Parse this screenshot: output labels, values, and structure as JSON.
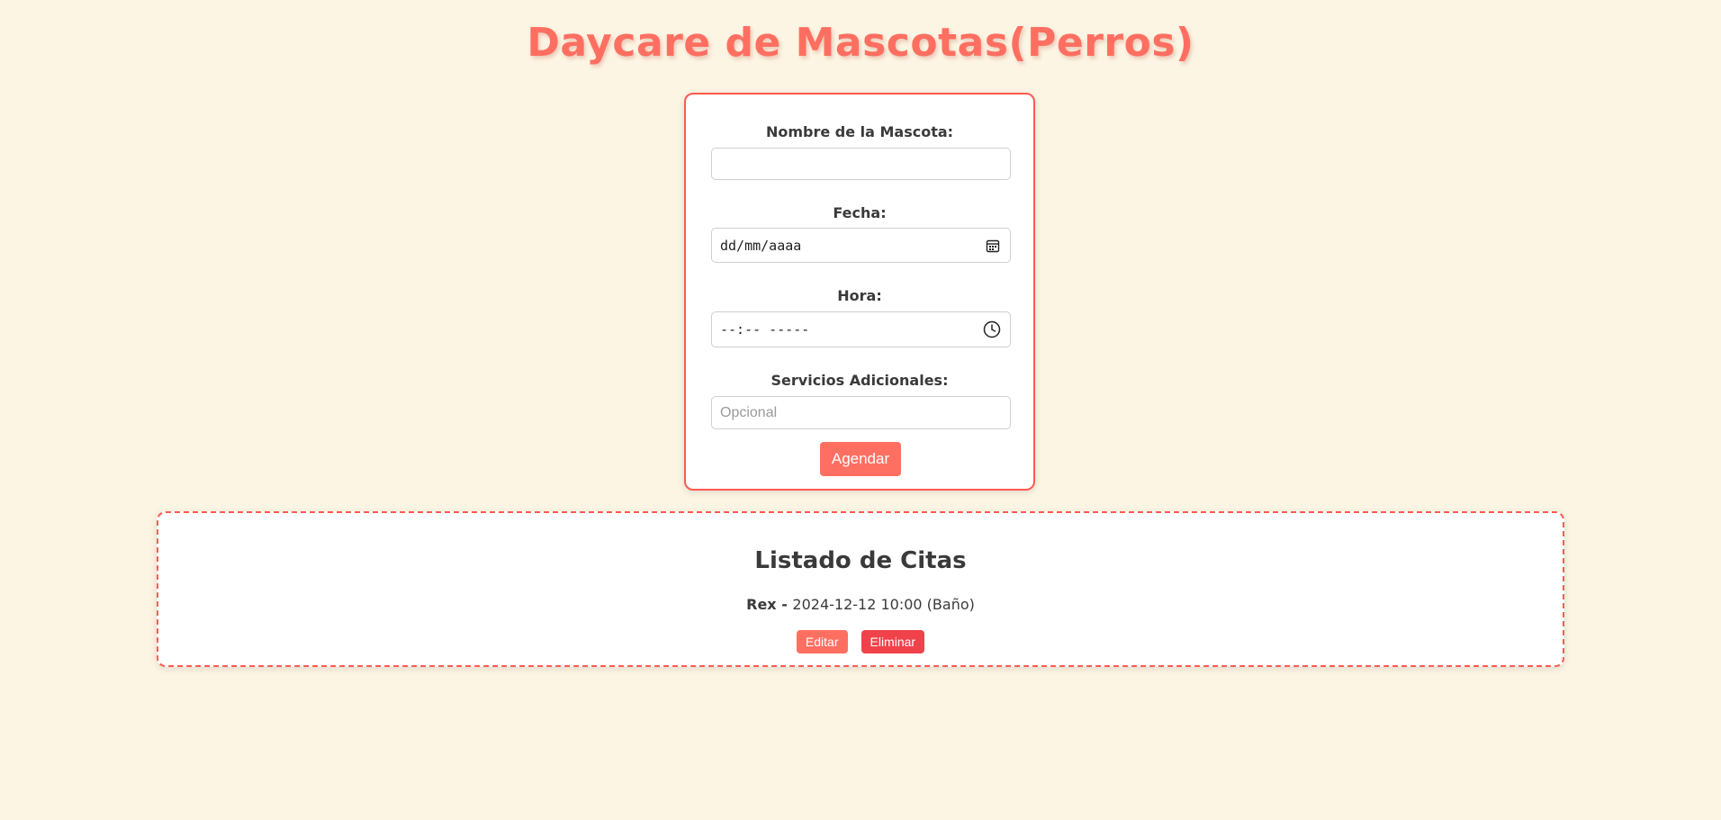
{
  "header": {
    "title": "Daycare de Mascotas(Perros)"
  },
  "form": {
    "pet_name": {
      "label": "Nombre de la Mascota:",
      "value": ""
    },
    "date": {
      "label": "Fecha:",
      "value": "dd/mm/aaaa",
      "icon": "calendar-icon"
    },
    "time": {
      "label": "Hora:",
      "value": "--:-- -----",
      "icon": "clock-icon"
    },
    "services": {
      "label": "Servicios Adicionales:",
      "placeholder": "Opcional"
    },
    "submit_label": "Agendar"
  },
  "appointments": {
    "title": "Listado de Citas",
    "items": [
      {
        "name": "Rex",
        "separator": " - ",
        "details": "2024-12-12 10:00 (Baño)",
        "edit_label": "Editar",
        "delete_label": "Eliminar"
      }
    ]
  },
  "colors": {
    "accent": "#ff6f61",
    "danger": "#f0424a",
    "background": "#fdf5e4",
    "border": "#ff5a52"
  }
}
